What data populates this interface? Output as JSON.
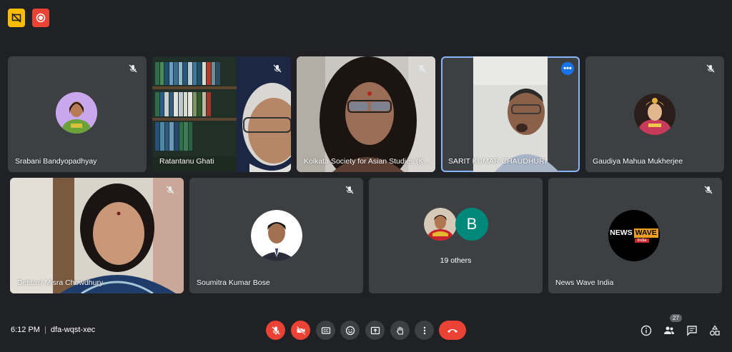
{
  "participants": [
    {
      "name": "Srabani Bandyopadhyay"
    },
    {
      "name": "Ratantanu Ghati"
    },
    {
      "name": "Kolkata Society for Asian Studies (KS..."
    },
    {
      "name": "SARIT KUMAR CHAUDHURI"
    },
    {
      "name": "Gaudiya Mahua Mukherjee"
    },
    {
      "name": "Debtusi Misra Chowdhury"
    },
    {
      "name": "Soumitra Kumar Bose"
    },
    {
      "name": "News Wave India"
    }
  ],
  "others_tile": {
    "avatar_letter": "B",
    "label": "19 others"
  },
  "news_logo": {
    "line1": "NEWS",
    "line2": "WAVE",
    "line3": "India"
  },
  "meeting": {
    "time": "6:12 PM",
    "separator": "|",
    "code": "dfa-wqst-xec"
  },
  "people_count": "27",
  "icons": {
    "top": [
      "screen-share-off-icon",
      "record-icon"
    ],
    "controls": [
      "mic-off-icon",
      "camera-off-icon",
      "captions-icon",
      "emoji-icon",
      "present-icon",
      "raise-hand-icon",
      "more-options-icon",
      "hang-up-icon"
    ],
    "right": [
      "info-icon",
      "people-icon",
      "chat-icon",
      "activities-icon"
    ]
  },
  "colors": {
    "background": "#202124",
    "tile": "#3c4043",
    "red": "#ea4335",
    "yellow": "#fbbc04",
    "active_outline": "#8ab4f8",
    "avatar_b": "#00897b"
  }
}
